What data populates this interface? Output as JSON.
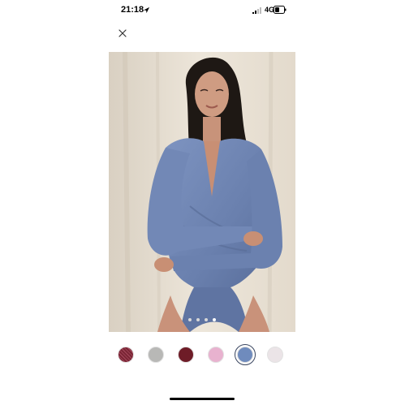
{
  "status_bar": {
    "time": "21:18",
    "network": "4G",
    "icons": [
      "location-arrow-icon",
      "signal-bars-icon",
      "battery-icon"
    ]
  },
  "close_icon": "close-icon",
  "product_image": {
    "background_color": "#e4dccf",
    "garment_color": "#6d83b1",
    "carousel": {
      "count": 4,
      "active_index": 3
    }
  },
  "color_swatches": [
    {
      "color": "#7a2535",
      "pattern": "striped"
    },
    {
      "color": "#b8b8b6"
    },
    {
      "color": "#6e1c27"
    },
    {
      "color": "#e8b2cf"
    },
    {
      "color": "#6f8bbd",
      "selected": true
    },
    {
      "color": "#ebe4e7"
    }
  ]
}
